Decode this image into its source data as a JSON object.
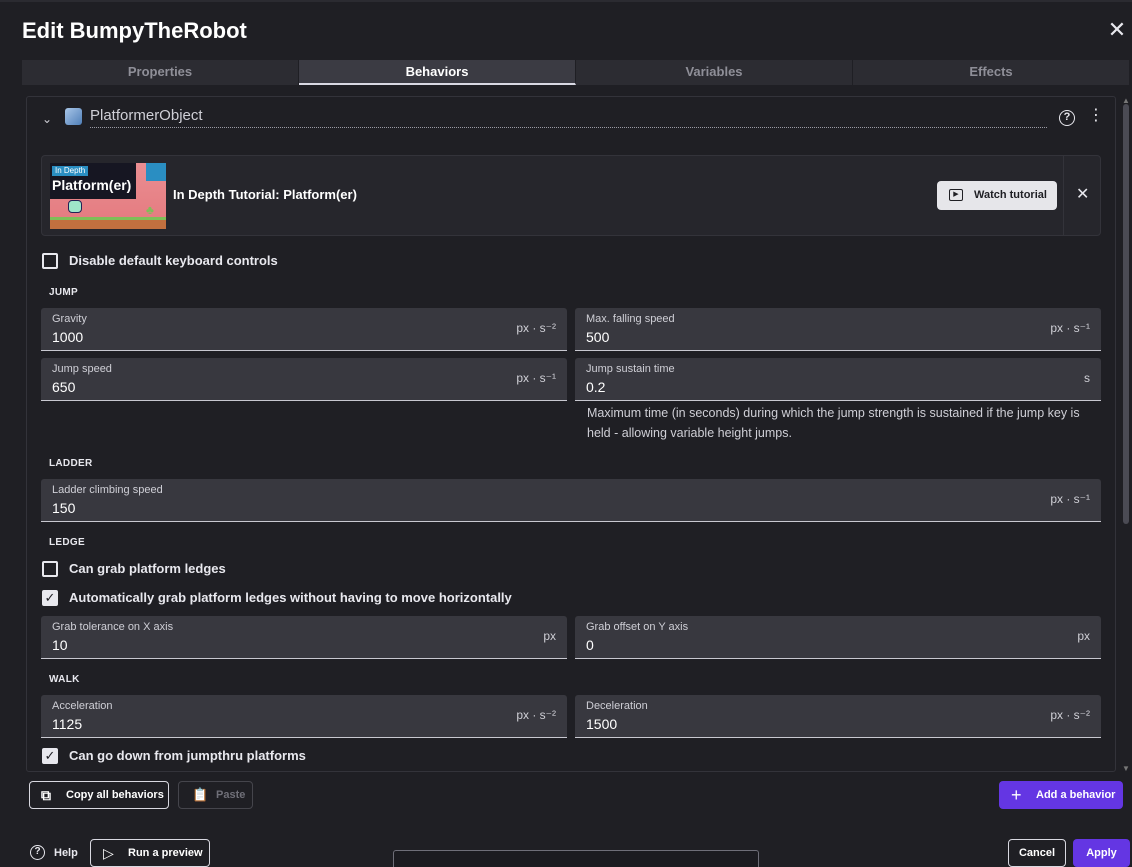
{
  "dialog": {
    "title": "Edit BumpyTheRobot"
  },
  "tabs": [
    {
      "label": "Properties"
    },
    {
      "label": "Behaviors"
    },
    {
      "label": "Variables"
    },
    {
      "label": "Effects"
    }
  ],
  "behavior": {
    "name": "PlatformerObject",
    "tutorial": {
      "thumbnail_badge": "In Depth",
      "thumbnail_title": "Platform(er)",
      "title": "In Depth Tutorial: Platform(er)",
      "watch_label": "Watch tutorial"
    },
    "disable_keyboard": {
      "label": "Disable default keyboard controls",
      "checked": false
    },
    "sections": {
      "jump": "JUMP",
      "ladder": "LADDER",
      "ledge": "LEDGE",
      "walk": "WALK"
    },
    "fields": {
      "gravity": {
        "label": "Gravity",
        "value": "1000",
        "unit": "px · s⁻²"
      },
      "max_falling_speed": {
        "label": "Max. falling speed",
        "value": "500",
        "unit": "px · s⁻¹"
      },
      "jump_speed": {
        "label": "Jump speed",
        "value": "650",
        "unit": "px · s⁻¹"
      },
      "jump_sustain_time": {
        "label": "Jump sustain time",
        "value": "0.2",
        "unit": "s"
      },
      "ladder_climbing_speed": {
        "label": "Ladder climbing speed",
        "value": "150",
        "unit": "px · s⁻¹"
      },
      "grab_tolerance_x": {
        "label": "Grab tolerance on X axis",
        "value": "10",
        "unit": "px"
      },
      "grab_offset_y": {
        "label": "Grab offset on Y axis",
        "value": "0",
        "unit": "px"
      },
      "acceleration": {
        "label": "Acceleration",
        "value": "1125",
        "unit": "px · s⁻²"
      },
      "deceleration": {
        "label": "Deceleration",
        "value": "1500",
        "unit": "px · s⁻²"
      }
    },
    "jump_sustain_help": "Maximum time (in seconds) during which the jump strength is sustained if the jump key is held - allowing variable height jumps.",
    "can_grab_ledges": {
      "label": "Can grab platform ledges",
      "checked": false
    },
    "auto_grab_ledges": {
      "label": "Automatically grab platform ledges without having to move horizontally",
      "checked": true
    },
    "can_go_down_jumpthru": {
      "label": "Can go down from jumpthru platforms",
      "checked": true
    }
  },
  "actions": {
    "copy_all": "Copy all behaviors",
    "paste": "Paste",
    "add_behavior": "Add a behavior"
  },
  "footer": {
    "help": "Help",
    "run_preview": "Run a preview",
    "cancel": "Cancel",
    "apply": "Apply"
  },
  "colors": {
    "background": "#1f1f24",
    "field": "#38383f",
    "primary": "#6436e3"
  }
}
